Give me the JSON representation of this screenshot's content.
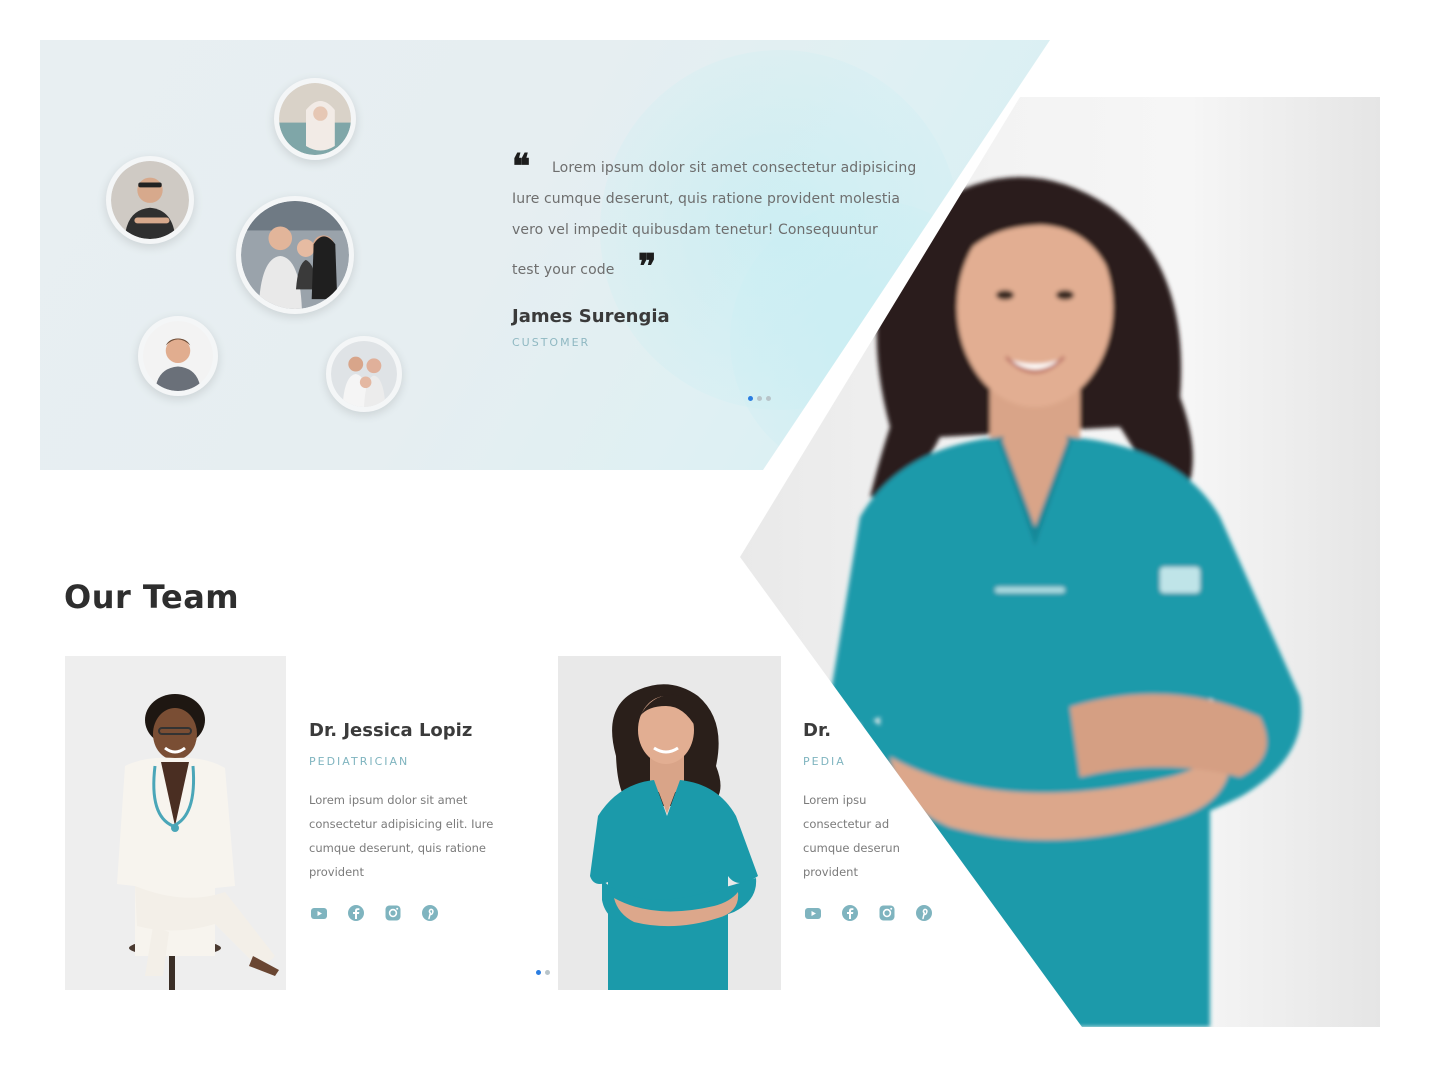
{
  "testimonial": {
    "quote_lines": [
      "Lorem ipsum dolor sit amet consectetur adipisicing",
      "Iure cumque deserunt, quis ratione provident molestia",
      "vero vel impedit quibusdam tenetur! Consequuntur",
      "test your code"
    ],
    "open_quote": "❝",
    "close_quote": "❞",
    "author_name": "James Surengia",
    "author_role": "CUSTOMER",
    "slider_dots": 3,
    "active_dot": 0
  },
  "team": {
    "title": "Our Team",
    "members": [
      {
        "name": "Dr. Jessica Lopiz",
        "role": "PEDIATRICIAN",
        "bio_lines": [
          "Lorem ipsum dolor sit amet",
          "consectetur adipisicing elit. Iure",
          "cumque deserunt, quis ratione",
          "provident"
        ],
        "socials": [
          "youtube-icon",
          "facebook-icon",
          "instagram-icon",
          "pinterest-icon"
        ]
      },
      {
        "name": "Dr.",
        "role": "PEDIA",
        "bio_lines": [
          "Lorem ipsu",
          "consectetur ad",
          "cumque deserun",
          "provident"
        ],
        "socials": [
          "youtube-icon",
          "facebook-icon",
          "instagram-icon",
          "pinterest-icon"
        ]
      }
    ],
    "slider_dots": 2,
    "active_dot": 0
  },
  "colors": {
    "accent": "#7fb4bf",
    "scrubs": "#1b9aaa",
    "active_dot": "#2a7de1"
  }
}
